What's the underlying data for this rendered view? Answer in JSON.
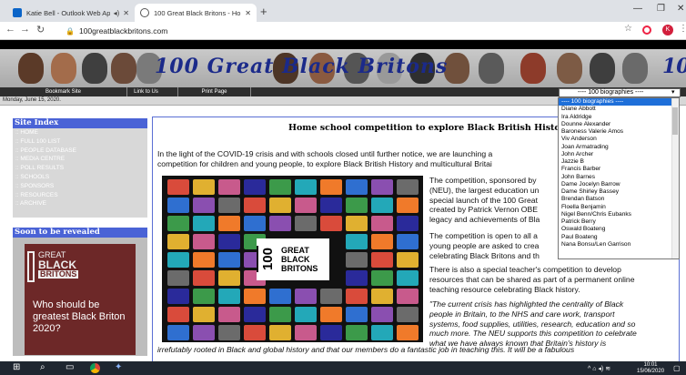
{
  "browser": {
    "tabs": [
      {
        "title": "Katie Bell - Outlook Web Ap",
        "active": false
      },
      {
        "title": "100 Great Black Britons - Homep",
        "active": true
      }
    ],
    "url": "100greatblackbritons.com",
    "extension_badge": "K"
  },
  "site": {
    "logo_text": "100 Great Black Britons",
    "logo_fragment": "10",
    "nav": [
      "Bookmark Site",
      "Link to Us",
      "Print Page"
    ],
    "date": "Monday, June 15, 2020.",
    "select_value": "---- 100 biographies ----"
  },
  "sidebar": {
    "index_title": "Site Index",
    "links": [
      ":: HOME",
      ":: FULL 100 LIST",
      ":: PEOPLE DATABASE",
      ":: MEDIA CENTRE",
      ":: POLL RESULTS",
      ":: SCHOOLS",
      ":: SPONSORS",
      ":: RESOURCES",
      ":: ARCHIVE"
    ],
    "promo_title": "Soon to be revealed",
    "promo_logo_words": [
      "GREAT",
      "BLACK",
      "BRITONS"
    ],
    "promo_text": "Who should be greatest Black Briton 2020?"
  },
  "main": {
    "heading": "Home school competition to explore Black British History",
    "intro": "In the light of the COVID-19 crisis and with schools closed until further notice, we are launching a",
    "intro2": "competition for children and young people, to explore Black British History and multicultural Britai",
    "collage_number": "100",
    "collage_words": "GREAT BLACK BRITONS",
    "para1": [
      "The competition, sponsored by",
      "(NEU), the largest education un",
      "special launch of the 100 Great",
      "created by Patrick Vernon OBE",
      "legacy and achievements of Bla"
    ],
    "para2": [
      "The competition is open to all a",
      "young people are asked to crea",
      "celebrating Black Britons and th"
    ],
    "para3": [
      "There is also a special teacher's competition to develop",
      "resources that can be shared as part of a permanent online",
      "teaching resource celebrating Black history."
    ],
    "quote": [
      "\"The current crisis has highlighted the centrality of Black",
      "people in Britain, to the NHS and care work, transport",
      "systems, food supplies, utilities, research, education and so",
      "much more. The NEU supports this competition to celebrate",
      "what we have always known that Britain's history is"
    ],
    "bottom_line": "irrefutably rooted in Black and global history and that our members do a fantastic job in teaching this. It will be a fabulous"
  },
  "dropdown": {
    "options": [
      "---- 100 biographies ----",
      "Diane Abbott",
      "Ira Aldridge",
      "Dounne Alexander",
      "Baroness Valerie Amos",
      "Viv Anderson",
      "Joan Armatrading",
      "John Archer",
      "Jazzie B",
      "Francis Barber",
      "John Barnes",
      "Dame Jocelyn Barrow",
      "Dame Shirley Bassey",
      "Brendan Batson",
      "Floella Benjamin",
      "Nigel Benn/Chris Eubanks",
      "Patrick Berry",
      "Oswald Boateng",
      "Paul Boateng",
      "Nana Bonsu/Len Garrison"
    ]
  },
  "taskbar": {
    "time": "10:01",
    "date": "15/06/2020"
  },
  "colors": {
    "accent": "#4a63d6",
    "logo": "#1b2a8a",
    "selected": "#1e6fd9"
  }
}
